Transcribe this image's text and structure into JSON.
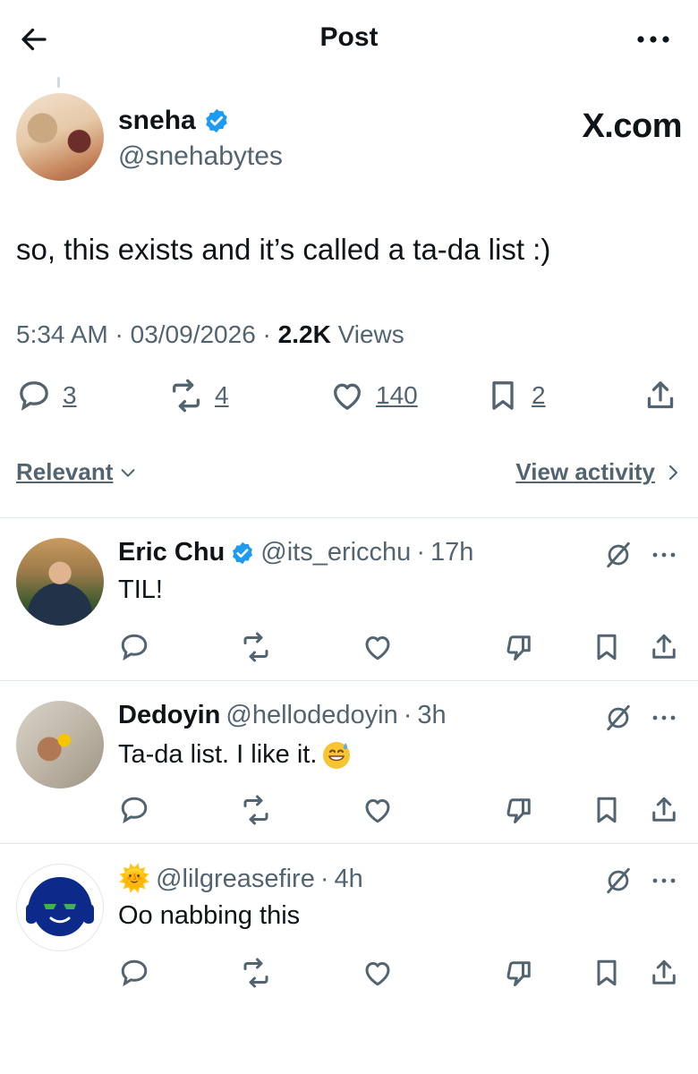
{
  "topbar": {
    "title": "Post"
  },
  "post": {
    "author_name": "sneha",
    "author_handle": "@snehabytes",
    "source_label": "X.com",
    "text": "so, this exists and it’s called a ta-da list :)",
    "time": "5:34 AM",
    "date": "03/09/2026",
    "views_count": "2.2K",
    "views_label": "Views",
    "replies": "3",
    "reposts": "4",
    "likes": "140",
    "bookmarks": "2"
  },
  "sort": {
    "left_label": "Relevant",
    "right_label": "View activity"
  },
  "replies": [
    {
      "name": "Eric Chu",
      "verified": true,
      "handle": "@its_ericchu",
      "time": "17h",
      "text": "TIL!"
    },
    {
      "name": "Dedoyin",
      "verified": false,
      "handle": "@hellodedoyin",
      "time": "3h",
      "text": "Ta-da list. I like it."
    },
    {
      "name": "",
      "emoji": "🌞",
      "verified": false,
      "handle": "@lilgreasefire",
      "time": "4h",
      "text": "Oo nabbing this"
    }
  ],
  "colors": {
    "text": "#0f1419",
    "secondary": "#536471",
    "verified": "#1d9bf0",
    "divider": "#e1e6ea"
  },
  "icons": [
    "back-arrow-icon",
    "more-icon",
    "reply-icon",
    "repost-icon",
    "like-icon",
    "bookmark-icon",
    "share-icon",
    "dislike-icon",
    "grok-icon",
    "verified-badge-icon",
    "chevron-down-icon",
    "chevron-right-icon"
  ]
}
